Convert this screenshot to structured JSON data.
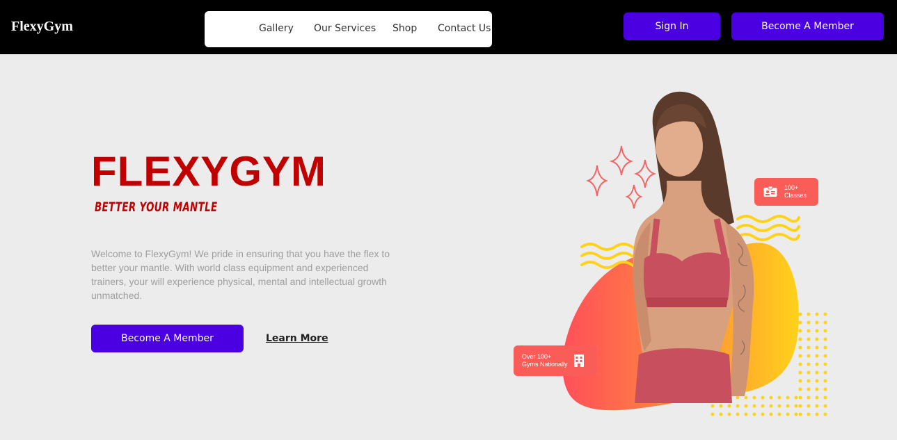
{
  "header": {
    "logo": "FlexyGym",
    "nav": [
      "Gallery",
      "Our Services",
      "Shop",
      "Contact Us"
    ],
    "sign_in_label": "Sign In",
    "member_label": "Become A Member"
  },
  "hero": {
    "title": "FLEXYGYM",
    "tagline": "BETTER YOUR MANTLE",
    "intro": "Welcome to FlexyGym! We pride in ensuring that you have the flex to better your mantle. With world class equipment and experienced trainers, your will experience physical, mental and intellectual growth unmatched.",
    "cta_label": "Become A Member",
    "learn_more_label": "Learn More"
  },
  "badges": {
    "classes_line1": "100+",
    "classes_line2": "Classes",
    "classes_icon": "id-card-icon",
    "gyms_line1": "Over 100+",
    "gyms_line2": "Gyms Nationally",
    "gyms_icon": "building-icon"
  },
  "colors": {
    "brand_purple": "#4a00e0",
    "title_red": "#c00000",
    "badge_coral": "#fa5c58",
    "accent_yellow": "#ffd21a"
  }
}
